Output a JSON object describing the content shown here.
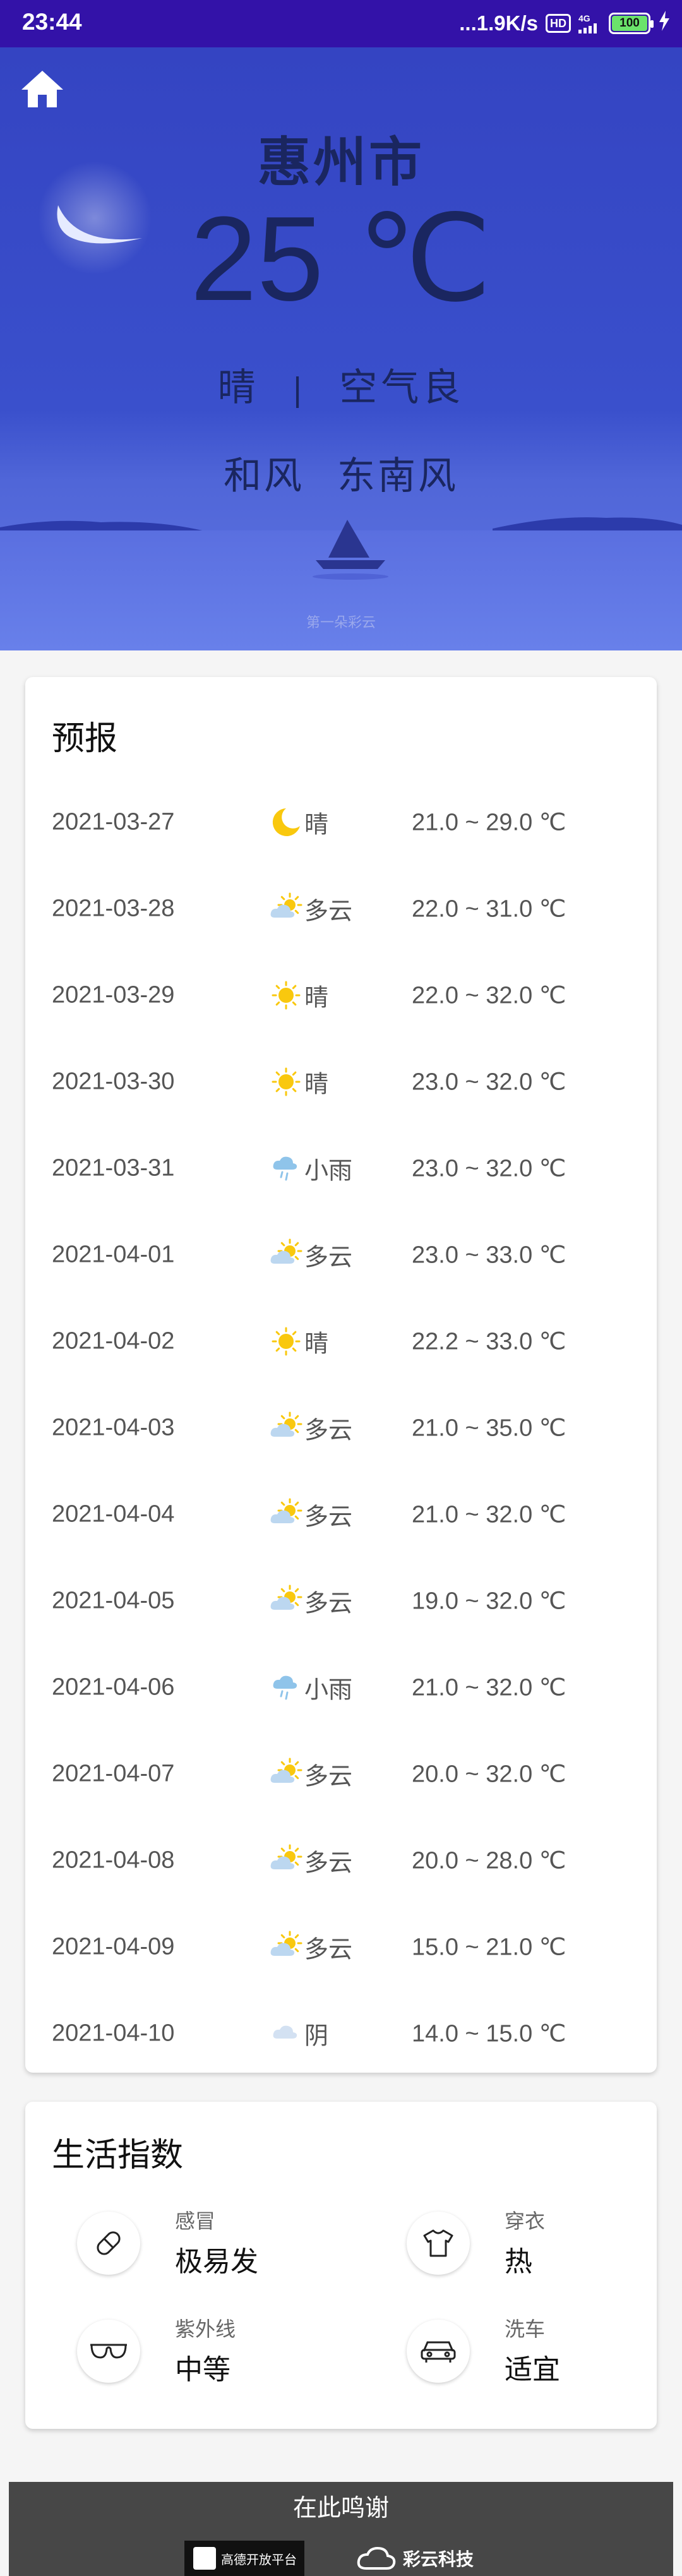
{
  "status_bar": {
    "time": "23:44",
    "network_speed": "...1.9K/s",
    "hd_badge": "HD",
    "signal_text": "4G",
    "battery_percent": "100"
  },
  "current": {
    "city": "惠州市",
    "temperature": "25 ℃",
    "condition": "晴",
    "separator": "|",
    "air_quality": "空气良",
    "wind_force": "和风",
    "wind_direction": "东南风",
    "credit": "第一朵彩云"
  },
  "forecast": {
    "title": "预报",
    "days": [
      {
        "date": "2021-03-27",
        "icon": "moon-icon",
        "desc": "晴",
        "temp": "21.0 ~ 29.0 ℃"
      },
      {
        "date": "2021-03-28",
        "icon": "partly-cloudy-icon",
        "desc": "多云",
        "temp": "22.0 ~ 31.0 ℃"
      },
      {
        "date": "2021-03-29",
        "icon": "sun-icon",
        "desc": "晴",
        "temp": "22.0 ~ 32.0 ℃"
      },
      {
        "date": "2021-03-30",
        "icon": "sun-icon",
        "desc": "晴",
        "temp": "23.0 ~ 32.0 ℃"
      },
      {
        "date": "2021-03-31",
        "icon": "light-rain-icon",
        "desc": "小雨",
        "temp": "23.0 ~ 32.0 ℃"
      },
      {
        "date": "2021-04-01",
        "icon": "partly-cloudy-icon",
        "desc": "多云",
        "temp": "23.0 ~ 33.0 ℃"
      },
      {
        "date": "2021-04-02",
        "icon": "sun-icon",
        "desc": "晴",
        "temp": "22.2 ~ 33.0 ℃"
      },
      {
        "date": "2021-04-03",
        "icon": "partly-cloudy-icon",
        "desc": "多云",
        "temp": "21.0 ~ 35.0 ℃"
      },
      {
        "date": "2021-04-04",
        "icon": "partly-cloudy-icon",
        "desc": "多云",
        "temp": "21.0 ~ 32.0 ℃"
      },
      {
        "date": "2021-04-05",
        "icon": "partly-cloudy-icon",
        "desc": "多云",
        "temp": "19.0 ~ 32.0 ℃"
      },
      {
        "date": "2021-04-06",
        "icon": "light-rain-icon",
        "desc": "小雨",
        "temp": "21.0 ~ 32.0 ℃"
      },
      {
        "date": "2021-04-07",
        "icon": "partly-cloudy-icon",
        "desc": "多云",
        "temp": "20.0 ~ 32.0 ℃"
      },
      {
        "date": "2021-04-08",
        "icon": "partly-cloudy-icon",
        "desc": "多云",
        "temp": "20.0 ~ 28.0 ℃"
      },
      {
        "date": "2021-04-09",
        "icon": "partly-cloudy-icon",
        "desc": "多云",
        "temp": "15.0 ~ 21.0 ℃"
      },
      {
        "date": "2021-04-10",
        "icon": "overcast-icon",
        "desc": "阴",
        "temp": "14.0 ~ 15.0 ℃"
      }
    ]
  },
  "life_index": {
    "title": "生活指数",
    "cold": {
      "label": "感冒",
      "value": "极易发",
      "icon": "pill-icon"
    },
    "dressing": {
      "label": "穿衣",
      "value": "热",
      "icon": "tshirt-icon"
    },
    "uv": {
      "label": "紫外线",
      "value": "中等",
      "icon": "sunglasses-icon"
    },
    "car_wash": {
      "label": "洗车",
      "value": "适宜",
      "icon": "car-icon"
    }
  },
  "footer": {
    "thanks": "在此鸣谢",
    "logo_1_text": "高德开放平台",
    "logo_2_text": "彩云科技"
  },
  "colors": {
    "status_bar": "#3312a8",
    "hero_top": "#3444c2",
    "hero_text": "#1a2660",
    "sun": "#f9c80e",
    "cloud": "#bcd7f0",
    "rain_cloud": "#8fc4ea",
    "footer_bg": "#474747"
  }
}
